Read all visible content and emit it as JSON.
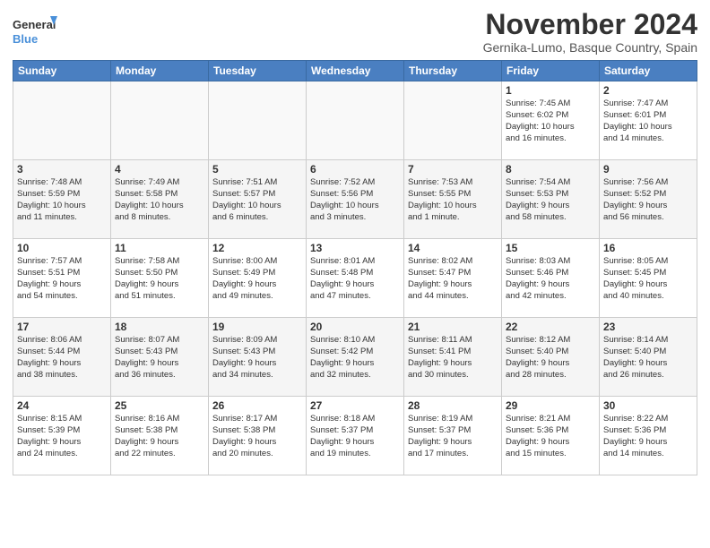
{
  "logo": {
    "line1": "General",
    "line2": "Blue"
  },
  "title": "November 2024",
  "subtitle": "Gernika-Lumo, Basque Country, Spain",
  "headers": [
    "Sunday",
    "Monday",
    "Tuesday",
    "Wednesday",
    "Thursday",
    "Friday",
    "Saturday"
  ],
  "weeks": [
    [
      {
        "day": "",
        "info": ""
      },
      {
        "day": "",
        "info": ""
      },
      {
        "day": "",
        "info": ""
      },
      {
        "day": "",
        "info": ""
      },
      {
        "day": "",
        "info": ""
      },
      {
        "day": "1",
        "info": "Sunrise: 7:45 AM\nSunset: 6:02 PM\nDaylight: 10 hours\nand 16 minutes."
      },
      {
        "day": "2",
        "info": "Sunrise: 7:47 AM\nSunset: 6:01 PM\nDaylight: 10 hours\nand 14 minutes."
      }
    ],
    [
      {
        "day": "3",
        "info": "Sunrise: 7:48 AM\nSunset: 5:59 PM\nDaylight: 10 hours\nand 11 minutes."
      },
      {
        "day": "4",
        "info": "Sunrise: 7:49 AM\nSunset: 5:58 PM\nDaylight: 10 hours\nand 8 minutes."
      },
      {
        "day": "5",
        "info": "Sunrise: 7:51 AM\nSunset: 5:57 PM\nDaylight: 10 hours\nand 6 minutes."
      },
      {
        "day": "6",
        "info": "Sunrise: 7:52 AM\nSunset: 5:56 PM\nDaylight: 10 hours\nand 3 minutes."
      },
      {
        "day": "7",
        "info": "Sunrise: 7:53 AM\nSunset: 5:55 PM\nDaylight: 10 hours\nand 1 minute."
      },
      {
        "day": "8",
        "info": "Sunrise: 7:54 AM\nSunset: 5:53 PM\nDaylight: 9 hours\nand 58 minutes."
      },
      {
        "day": "9",
        "info": "Sunrise: 7:56 AM\nSunset: 5:52 PM\nDaylight: 9 hours\nand 56 minutes."
      }
    ],
    [
      {
        "day": "10",
        "info": "Sunrise: 7:57 AM\nSunset: 5:51 PM\nDaylight: 9 hours\nand 54 minutes."
      },
      {
        "day": "11",
        "info": "Sunrise: 7:58 AM\nSunset: 5:50 PM\nDaylight: 9 hours\nand 51 minutes."
      },
      {
        "day": "12",
        "info": "Sunrise: 8:00 AM\nSunset: 5:49 PM\nDaylight: 9 hours\nand 49 minutes."
      },
      {
        "day": "13",
        "info": "Sunrise: 8:01 AM\nSunset: 5:48 PM\nDaylight: 9 hours\nand 47 minutes."
      },
      {
        "day": "14",
        "info": "Sunrise: 8:02 AM\nSunset: 5:47 PM\nDaylight: 9 hours\nand 44 minutes."
      },
      {
        "day": "15",
        "info": "Sunrise: 8:03 AM\nSunset: 5:46 PM\nDaylight: 9 hours\nand 42 minutes."
      },
      {
        "day": "16",
        "info": "Sunrise: 8:05 AM\nSunset: 5:45 PM\nDaylight: 9 hours\nand 40 minutes."
      }
    ],
    [
      {
        "day": "17",
        "info": "Sunrise: 8:06 AM\nSunset: 5:44 PM\nDaylight: 9 hours\nand 38 minutes."
      },
      {
        "day": "18",
        "info": "Sunrise: 8:07 AM\nSunset: 5:43 PM\nDaylight: 9 hours\nand 36 minutes."
      },
      {
        "day": "19",
        "info": "Sunrise: 8:09 AM\nSunset: 5:43 PM\nDaylight: 9 hours\nand 34 minutes."
      },
      {
        "day": "20",
        "info": "Sunrise: 8:10 AM\nSunset: 5:42 PM\nDaylight: 9 hours\nand 32 minutes."
      },
      {
        "day": "21",
        "info": "Sunrise: 8:11 AM\nSunset: 5:41 PM\nDaylight: 9 hours\nand 30 minutes."
      },
      {
        "day": "22",
        "info": "Sunrise: 8:12 AM\nSunset: 5:40 PM\nDaylight: 9 hours\nand 28 minutes."
      },
      {
        "day": "23",
        "info": "Sunrise: 8:14 AM\nSunset: 5:40 PM\nDaylight: 9 hours\nand 26 minutes."
      }
    ],
    [
      {
        "day": "24",
        "info": "Sunrise: 8:15 AM\nSunset: 5:39 PM\nDaylight: 9 hours\nand 24 minutes."
      },
      {
        "day": "25",
        "info": "Sunrise: 8:16 AM\nSunset: 5:38 PM\nDaylight: 9 hours\nand 22 minutes."
      },
      {
        "day": "26",
        "info": "Sunrise: 8:17 AM\nSunset: 5:38 PM\nDaylight: 9 hours\nand 20 minutes."
      },
      {
        "day": "27",
        "info": "Sunrise: 8:18 AM\nSunset: 5:37 PM\nDaylight: 9 hours\nand 19 minutes."
      },
      {
        "day": "28",
        "info": "Sunrise: 8:19 AM\nSunset: 5:37 PM\nDaylight: 9 hours\nand 17 minutes."
      },
      {
        "day": "29",
        "info": "Sunrise: 8:21 AM\nSunset: 5:36 PM\nDaylight: 9 hours\nand 15 minutes."
      },
      {
        "day": "30",
        "info": "Sunrise: 8:22 AM\nSunset: 5:36 PM\nDaylight: 9 hours\nand 14 minutes."
      }
    ]
  ]
}
